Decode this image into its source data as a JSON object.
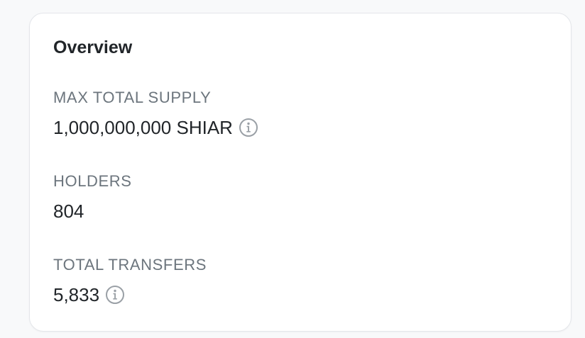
{
  "overview": {
    "title": "Overview",
    "max_total_supply": {
      "label": "MAX TOTAL SUPPLY",
      "value": "1,000,000,000 SHIAR",
      "icon": "info-icon"
    },
    "holders": {
      "label": "HOLDERS",
      "value": "804"
    },
    "total_transfers": {
      "label": "TOTAL TRANSFERS",
      "value": "5,833",
      "icon": "info-icon"
    }
  },
  "colors": {
    "label": "#6c757d",
    "value": "#212529",
    "icon": "#9aa0a6",
    "card_border": "#e4e6ea"
  }
}
